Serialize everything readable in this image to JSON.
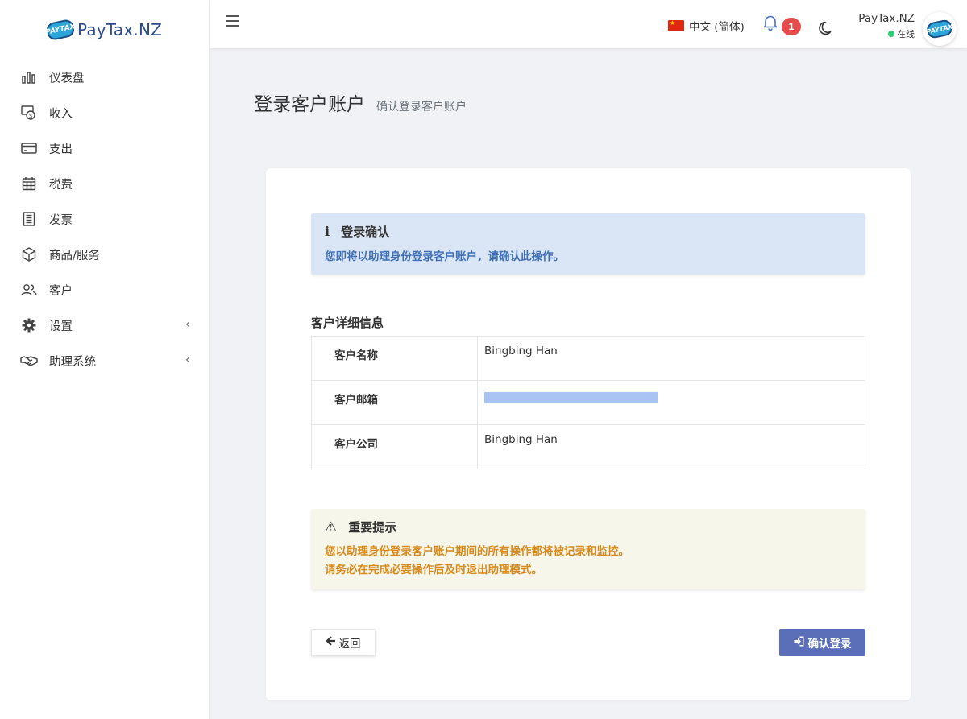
{
  "brand": {
    "logo_text": "PAYTAX",
    "name": "PayTax.NZ"
  },
  "sidebar": {
    "items": [
      {
        "label": "仪表盘",
        "icon": "bar-chart-icon"
      },
      {
        "label": "收入",
        "icon": "money-in-icon"
      },
      {
        "label": "支出",
        "icon": "credit-card-icon"
      },
      {
        "label": "税费",
        "icon": "calendar-icon"
      },
      {
        "label": "发票",
        "icon": "invoice-icon"
      },
      {
        "label": "商品/服务",
        "icon": "box-icon"
      },
      {
        "label": "客户",
        "icon": "users-icon"
      },
      {
        "label": "设置",
        "icon": "gear-icon",
        "chevron": "‹"
      },
      {
        "label": "助理系统",
        "icon": "handshake-icon",
        "chevron": "‹"
      }
    ]
  },
  "topbar": {
    "language": "中文 (简体)",
    "notification_count": "1",
    "user": {
      "name": "PayTax.NZ",
      "status": "在线"
    }
  },
  "page": {
    "title": "登录客户账户",
    "subtitle": "确认登录客户账户"
  },
  "info_alert": {
    "icon": "info-icon",
    "icon_glyph": "ℹ",
    "title": "登录确认",
    "text": "您即将以助理身份登录客户账户，请确认此操作。"
  },
  "details": {
    "title": "客户详细信息",
    "rows": [
      {
        "label": "客户名称",
        "value": "Bingbing Han"
      },
      {
        "label": "客户邮箱",
        "value": ""
      },
      {
        "label": "客户公司",
        "value": "Bingbing Han"
      }
    ]
  },
  "warning_alert": {
    "icon": "warning-icon",
    "icon_glyph": "⚠",
    "title": "重要提示",
    "line1": "您以助理身份登录客户账户期间的所有操作都将被记录和监控。",
    "line2": "请务必在完成必要操作后及时退出助理模式。"
  },
  "actions": {
    "back_label": "返回",
    "confirm_label": "确认登录"
  },
  "colors": {
    "accent": "#5a6fb7",
    "info_bg": "#dae5f5",
    "info_text": "#3f6fb5",
    "warn_bg": "#f6f6eb",
    "warn_text": "#d78a1e",
    "badge": "#e74c4c",
    "online": "#2ecc71"
  }
}
